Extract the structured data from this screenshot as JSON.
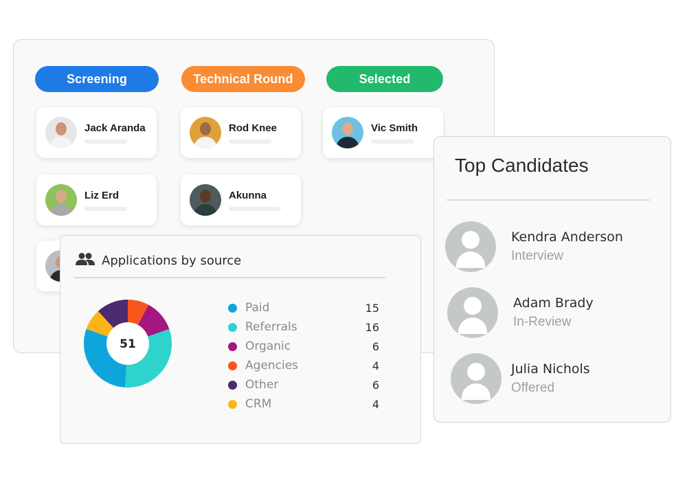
{
  "pipeline": {
    "stages": [
      {
        "label": "Screening",
        "color": "#1e7be6",
        "candidates": [
          {
            "name": "Jack Aranda",
            "avatar_bg": "#e6e6e6",
            "skin": "#c99573",
            "shirt": "#f4f4f4"
          },
          {
            "name": "Liz Erd",
            "avatar_bg": "#8fc25a",
            "skin": "#d8a98c",
            "shirt": "#a8a8a8"
          },
          {
            "name": "",
            "avatar_bg": "#b9bec4",
            "skin": "#c79a7a",
            "shirt": "#2a2a2a"
          }
        ]
      },
      {
        "label": "Technical Round",
        "color": "#fa8c34",
        "candidates": [
          {
            "name": "Rod Knee",
            "avatar_bg": "#e0a13a",
            "skin": "#9c6a48",
            "shirt": "#f5f5f5"
          },
          {
            "name": "Akunna",
            "avatar_bg": "#4e5b5e",
            "skin": "#5b3a26",
            "shirt": "#2b3d3d"
          }
        ]
      },
      {
        "label": "Selected",
        "color": "#22b96d",
        "candidates": [
          {
            "name": "Vic Smith",
            "avatar_bg": "#6cc2e0",
            "skin": "#e0a98a",
            "shirt": "#1e2a3a"
          }
        ]
      }
    ]
  },
  "applications": {
    "title": "Applications by source",
    "icon": "people-icon",
    "total": "51"
  },
  "chart_data": {
    "type": "pie",
    "title": "Applications by source",
    "center_label": "51",
    "categories": [
      "Paid",
      "Referrals",
      "Organic",
      "Agencies",
      "Other",
      "CRM"
    ],
    "values": [
      15,
      16,
      6,
      4,
      6,
      4
    ],
    "colors": [
      "#0ea5dd",
      "#2ed3cd",
      "#a3177f",
      "#f8551e",
      "#4b2a6e",
      "#fbb519"
    ],
    "draw_order_clockwise_from_top": [
      "Agencies",
      "Organic",
      "Referrals",
      "Paid",
      "CRM",
      "Other"
    ],
    "legend_position": "right"
  },
  "top_candidates": {
    "title": "Top Candidates",
    "items": [
      {
        "name": "Kendra Anderson",
        "status": "Interview"
      },
      {
        "name": "Adam Brady",
        "status": "In-Review"
      },
      {
        "name": "Julia Nichols",
        "status": "Offered"
      }
    ]
  }
}
